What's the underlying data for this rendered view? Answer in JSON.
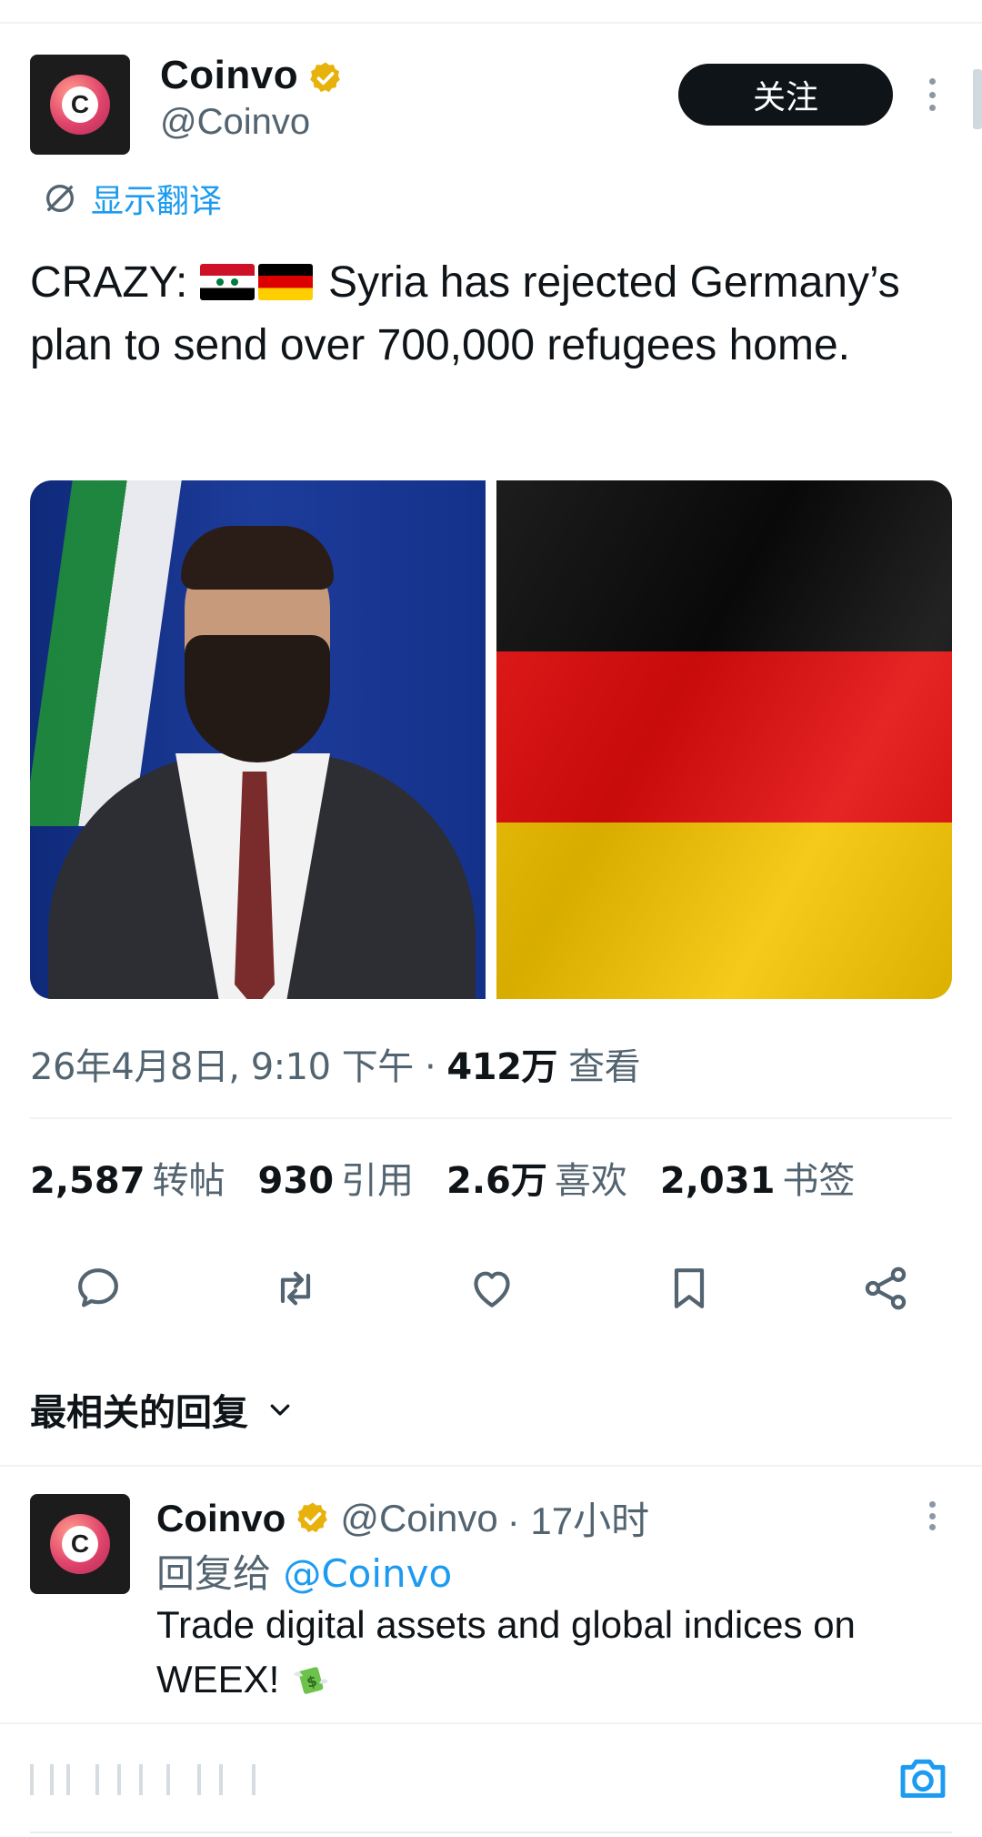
{
  "author": {
    "name": "Coinvo",
    "handle": "@Coinvo",
    "avatar_letter": "C",
    "verified_icon": "verified-badge-gold"
  },
  "follow_button": "关注",
  "translate_label": "显示翻译",
  "tweet": {
    "prefix": "CRAZY:",
    "flags": [
      "syria-flag",
      "germany-flag"
    ],
    "body": " Syria has rejected Germany’s plan to send over 700,000 refugees home."
  },
  "media": {
    "left_image": "man-in-suit-photo",
    "right_image": "germany-flag-photo"
  },
  "meta": {
    "date": "26年4月8日, 9:10 下午 · ",
    "views_count": "412万",
    "views_label": " 查看"
  },
  "stats": [
    {
      "count": "2,587",
      "label": "转帖"
    },
    {
      "count": "930",
      "label": "引用"
    },
    {
      "count": "2.6万",
      "label": "喜欢"
    },
    {
      "count": "2,031",
      "label": "书签"
    }
  ],
  "actions": [
    "reply-icon",
    "retweet-icon",
    "like-icon",
    "bookmark-icon",
    "share-icon"
  ],
  "replies_sort": "最相关的回复",
  "reply": {
    "name": "Coinvo",
    "handle": "@Coinvo",
    "time": "· 17小时",
    "replying_prefix": "回复给 ",
    "replying_to": "@Coinvo",
    "text": "Trade digital assets and global indices on WEEX!"
  },
  "colors": {
    "accent": "#1d9bf0",
    "text": "#0f1419",
    "muted": "#536471",
    "verified": "#e8b20c"
  }
}
